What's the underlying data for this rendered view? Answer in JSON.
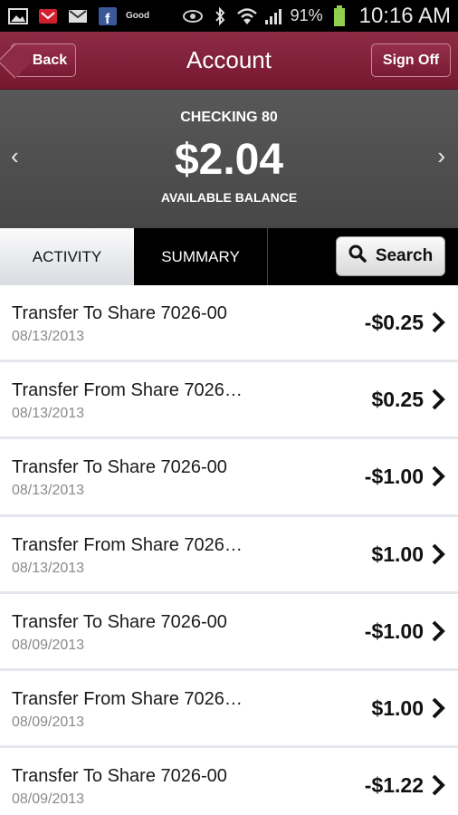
{
  "status_bar": {
    "battery": "91%",
    "time": "10:16 AM",
    "good_label": "Good",
    "icons": [
      "gallery-icon",
      "mail-red-icon",
      "gmail-icon",
      "facebook-icon",
      "good-icon",
      "eye-icon",
      "bluetooth-icon",
      "wifi-icon",
      "signal-icon",
      "battery-icon"
    ]
  },
  "header": {
    "title": "Account",
    "back_label": "Back",
    "signoff_label": "Sign Off"
  },
  "account": {
    "name": "CHECKING 80",
    "balance": "$2.04",
    "balance_label": "AVAILABLE BALANCE",
    "prev_arrow": "‹",
    "next_arrow": "›"
  },
  "tabs": {
    "activity": "ACTIVITY",
    "summary": "SUMMARY",
    "search": "Search"
  },
  "transactions": [
    {
      "title": "Transfer To Share 7026-00",
      "date": "08/13/2013",
      "amount": "-$0.25"
    },
    {
      "title": "Transfer From Share 7026…",
      "date": "08/13/2013",
      "amount": "$0.25"
    },
    {
      "title": "Transfer To Share 7026-00",
      "date": "08/13/2013",
      "amount": "-$1.00"
    },
    {
      "title": "Transfer From Share 7026…",
      "date": "08/13/2013",
      "amount": "$1.00"
    },
    {
      "title": "Transfer To Share 7026-00",
      "date": "08/09/2013",
      "amount": "-$1.00"
    },
    {
      "title": "Transfer From Share 7026…",
      "date": "08/09/2013",
      "amount": "$1.00"
    },
    {
      "title": "Transfer To Share 7026-00",
      "date": "08/09/2013",
      "amount": "-$1.22"
    }
  ],
  "colors": {
    "header": "#841f3a",
    "balance_panel": "#505050",
    "tabs_bar": "#000000"
  }
}
